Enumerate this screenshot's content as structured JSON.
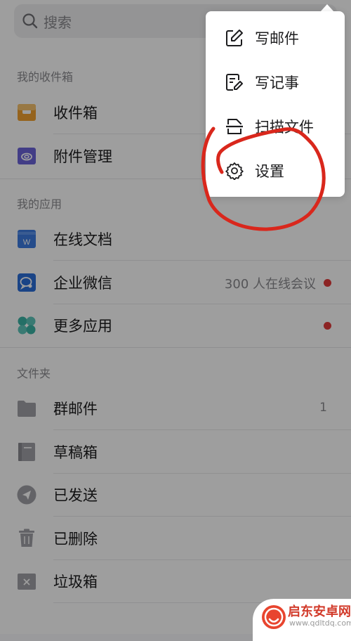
{
  "search": {
    "placeholder": "搜索"
  },
  "sections": {
    "mailboxes": "我的收件箱",
    "apps": "我的应用",
    "folders": "文件夹"
  },
  "mailboxes": [
    {
      "label": "收件箱",
      "icon": "inbox-icon"
    },
    {
      "label": "附件管理",
      "icon": "attachment-icon"
    }
  ],
  "apps": [
    {
      "label": "在线文档",
      "icon": "online-doc-icon"
    },
    {
      "label": "企业微信",
      "icon": "wecom-icon",
      "sub": "300 人在线会议"
    },
    {
      "label": "更多应用",
      "icon": "more-apps-icon"
    }
  ],
  "folders": [
    {
      "label": "群邮件",
      "icon": "folder-icon",
      "count": "1"
    },
    {
      "label": "草稿箱",
      "icon": "drafts-icon"
    },
    {
      "label": "已发送",
      "icon": "sent-icon"
    },
    {
      "label": "已删除",
      "icon": "trash-icon"
    },
    {
      "label": "垃圾箱",
      "icon": "spam-icon"
    }
  ],
  "menu": [
    {
      "label": "写邮件",
      "icon": "compose-icon"
    },
    {
      "label": "写记事",
      "icon": "note-icon"
    },
    {
      "label": "扫描文件",
      "icon": "scan-icon"
    },
    {
      "label": "设置",
      "icon": "gear-icon"
    }
  ],
  "watermark": {
    "brand": "启东安卓网",
    "url": "www.qdltdq.com"
  },
  "colors": {
    "accent_red": "#e23b3b",
    "annotation_red": "#d9271c",
    "inbox_orange": "#f0a030",
    "attachment_purple": "#6b63d8",
    "doc_blue": "#3d7be0",
    "wecom_blue": "#2b6ed8",
    "more_teal": "#3bb3a5"
  }
}
